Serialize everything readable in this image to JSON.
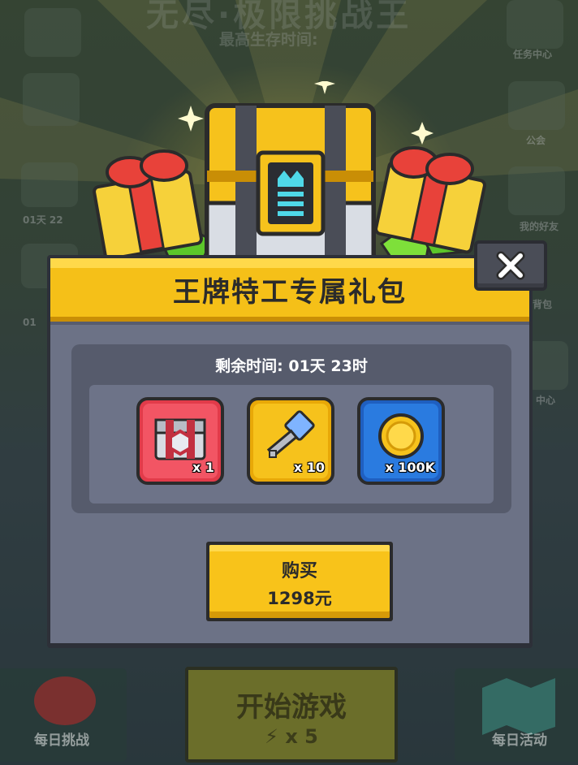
{
  "background": {
    "title": "无尽·极限挑战王",
    "subtitle": "最高生存时间:",
    "side_labels": {
      "tasks": "任务中心",
      "guild": "公会",
      "friends": "我的好友",
      "backpack": "背包",
      "center": "中心",
      "left_a": "01天 22",
      "left_b": "01"
    },
    "bottom": {
      "daily_challenge": "每日挑战",
      "start_game": "开始游戏",
      "energy_cost": "x 5",
      "daily_event": "每日活动"
    }
  },
  "dialog": {
    "title": "王牌特工专属礼包",
    "timer_label": "剩余时间: 01天 23时",
    "close_icon": "close-icon",
    "items": [
      {
        "icon": "chest-icon",
        "quantity": "x 1",
        "color": "#e23b4a"
      },
      {
        "icon": "key-icon",
        "quantity": "x 10",
        "color": "#f6c21c"
      },
      {
        "icon": "gold-coin-icon",
        "quantity": "x 100K",
        "color": "#2a7be0"
      }
    ],
    "buy": {
      "label": "购买",
      "price": "1298元"
    }
  },
  "colors": {
    "header_yellow": "#f5c018",
    "body_gray": "#6c7286",
    "button_yellow": "#f8c31a"
  }
}
